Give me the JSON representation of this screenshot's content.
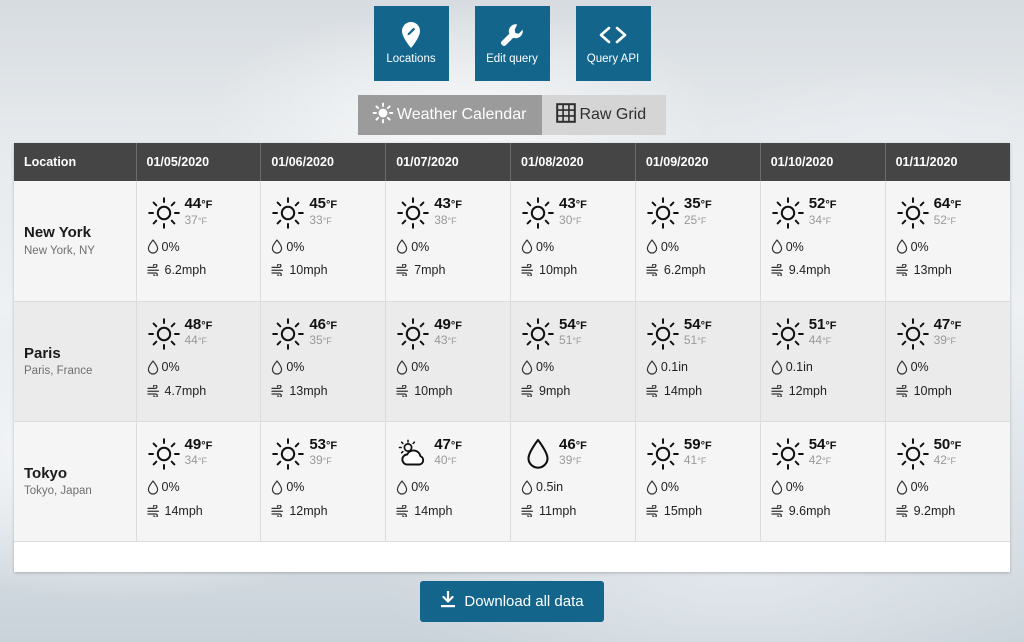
{
  "actions": [
    {
      "label": "Locations",
      "icon": "map-pin-icon"
    },
    {
      "label": "Edit query",
      "icon": "wrench-icon"
    },
    {
      "label": "Query API",
      "icon": "code-brackets-icon"
    }
  ],
  "tabs": [
    {
      "label": "Weather Calendar",
      "icon": "sun-icon",
      "active": true
    },
    {
      "label": "Raw Grid",
      "icon": "grid-icon",
      "active": false
    }
  ],
  "table": {
    "location_header": "Location",
    "dates": [
      "01/05/2020",
      "01/06/2020",
      "01/07/2020",
      "01/08/2020",
      "01/09/2020",
      "01/10/2020",
      "01/11/2020"
    ],
    "rows": [
      {
        "name": "New York",
        "sub": "New York, NY",
        "cells": [
          {
            "icon": "sun-icon",
            "high": "44",
            "low": "37",
            "unit": "°F",
            "precip": "0%",
            "wind": "6.2mph"
          },
          {
            "icon": "sun-icon",
            "high": "45",
            "low": "33",
            "unit": "°F",
            "precip": "0%",
            "wind": "10mph"
          },
          {
            "icon": "sun-icon",
            "high": "43",
            "low": "38",
            "unit": "°F",
            "precip": "0%",
            "wind": "7mph"
          },
          {
            "icon": "sun-icon",
            "high": "43",
            "low": "30",
            "unit": "°F",
            "precip": "0%",
            "wind": "10mph"
          },
          {
            "icon": "sun-icon",
            "high": "35",
            "low": "25",
            "unit": "°F",
            "precip": "0%",
            "wind": "6.2mph"
          },
          {
            "icon": "sun-icon",
            "high": "52",
            "low": "34",
            "unit": "°F",
            "precip": "0%",
            "wind": "9.4mph"
          },
          {
            "icon": "sun-icon",
            "high": "64",
            "low": "52",
            "unit": "°F",
            "precip": "0%",
            "wind": "13mph"
          }
        ]
      },
      {
        "name": "Paris",
        "sub": "Paris, France",
        "cells": [
          {
            "icon": "sun-icon",
            "high": "48",
            "low": "44",
            "unit": "°F",
            "precip": "0%",
            "wind": "4.7mph"
          },
          {
            "icon": "sun-icon",
            "high": "46",
            "low": "35",
            "unit": "°F",
            "precip": "0%",
            "wind": "13mph"
          },
          {
            "icon": "sun-icon",
            "high": "49",
            "low": "43",
            "unit": "°F",
            "precip": "0%",
            "wind": "10mph"
          },
          {
            "icon": "sun-icon",
            "high": "54",
            "low": "51",
            "unit": "°F",
            "precip": "0%",
            "wind": "9mph"
          },
          {
            "icon": "sun-icon",
            "high": "54",
            "low": "51",
            "unit": "°F",
            "precip": "0.1in",
            "wind": "14mph"
          },
          {
            "icon": "sun-icon",
            "high": "51",
            "low": "44",
            "unit": "°F",
            "precip": "0.1in",
            "wind": "12mph"
          },
          {
            "icon": "sun-icon",
            "high": "47",
            "low": "39",
            "unit": "°F",
            "precip": "0%",
            "wind": "10mph"
          }
        ]
      },
      {
        "name": "Tokyo",
        "sub": "Tokyo, Japan",
        "cells": [
          {
            "icon": "sun-icon",
            "high": "49",
            "low": "34",
            "unit": "°F",
            "precip": "0%",
            "wind": "14mph"
          },
          {
            "icon": "sun-icon",
            "high": "53",
            "low": "39",
            "unit": "°F",
            "precip": "0%",
            "wind": "12mph"
          },
          {
            "icon": "partly-cloudy-icon",
            "high": "47",
            "low": "40",
            "unit": "°F",
            "precip": "0%",
            "wind": "14mph"
          },
          {
            "icon": "raindrop-icon",
            "high": "46",
            "low": "39",
            "unit": "°F",
            "precip": "0.5in",
            "wind": "11mph"
          },
          {
            "icon": "sun-icon",
            "high": "59",
            "low": "41",
            "unit": "°F",
            "precip": "0%",
            "wind": "15mph"
          },
          {
            "icon": "sun-icon",
            "high": "54",
            "low": "42",
            "unit": "°F",
            "precip": "0%",
            "wind": "9.6mph"
          },
          {
            "icon": "sun-icon",
            "high": "50",
            "low": "42",
            "unit": "°F",
            "precip": "0%",
            "wind": "9.2mph"
          }
        ]
      }
    ]
  },
  "download": {
    "label": "Download all data",
    "icon": "download-icon"
  },
  "colors": {
    "accent": "#13658c",
    "header": "#454545",
    "tab_active": "#9b9b9b",
    "tab_inactive": "#d5d5d5"
  }
}
